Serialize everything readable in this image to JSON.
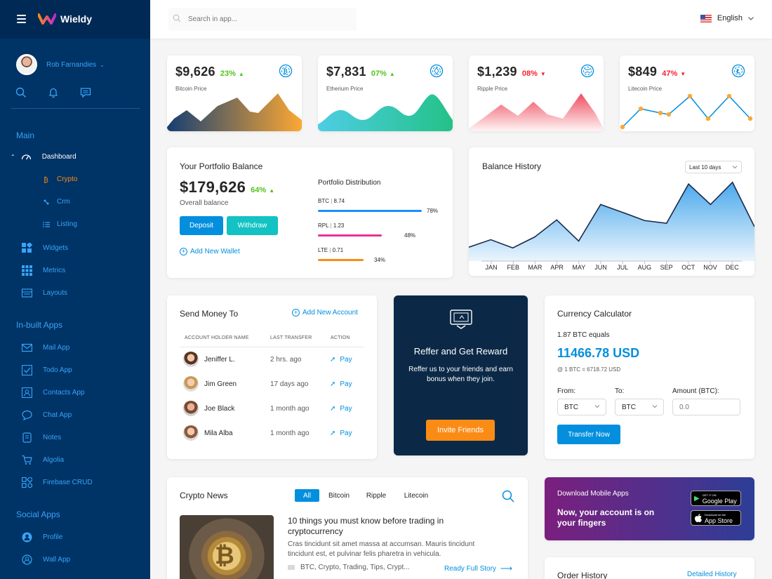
{
  "app": {
    "name": "Wieldy"
  },
  "colors": {
    "primary": "#038fde",
    "sidebar": "#003366",
    "sidebar_top": "#002a55",
    "orange": "#fa8c16",
    "up": "#52c41a",
    "down": "#f5222d",
    "dark_card": "#003366"
  },
  "sidebar": {
    "user_name": "Rob Farnandies",
    "quick_icons": [
      "search-icon",
      "bell-icon",
      "chat-icon"
    ],
    "sections": {
      "main": "Main",
      "inbuilt": "In-built Apps",
      "social": "Social Apps"
    },
    "main_items": [
      {
        "label": "Dashboard",
        "icon": "dashboard-icon"
      },
      {
        "label": "Crypto",
        "icon": "bitcoin-icon"
      },
      {
        "label": "Crm",
        "icon": "crm-icon"
      },
      {
        "label": "Listing",
        "icon": "list-icon"
      },
      {
        "label": "Widgets",
        "icon": "widgets-icon"
      },
      {
        "label": "Metrics",
        "icon": "metrics-icon"
      },
      {
        "label": "Layouts",
        "icon": "layouts-icon"
      }
    ],
    "app_items": [
      {
        "label": "Mail App",
        "icon": "mail-icon"
      },
      {
        "label": "Todo App",
        "icon": "todo-icon"
      },
      {
        "label": "Contacts App",
        "icon": "contacts-icon"
      },
      {
        "label": "Chat App",
        "icon": "chat-icon"
      },
      {
        "label": "Notes",
        "icon": "notes-icon"
      },
      {
        "label": "Algolia",
        "icon": "cart-icon"
      },
      {
        "label": "Firebase CRUD",
        "icon": "firebase-icon"
      }
    ],
    "social_items": [
      {
        "label": "Profile",
        "icon": "profile-icon"
      },
      {
        "label": "Wall App",
        "icon": "wall-icon"
      }
    ]
  },
  "topbar": {
    "search_placeholder": "Search in app...",
    "language": "English"
  },
  "prices": [
    {
      "value": "$9,626",
      "change": "23%",
      "direction": "up",
      "label": "Bitcoin Price",
      "icon": "bitcoin-icon"
    },
    {
      "value": "$7,831",
      "change": "07%",
      "direction": "up",
      "label": "Etherium Price",
      "icon": "ethereum-icon"
    },
    {
      "value": "$1,239",
      "change": "08%",
      "direction": "down",
      "label": "Ripple Price",
      "icon": "ripple-icon"
    },
    {
      "value": "$849",
      "change": "47%",
      "direction": "down",
      "label": "Litecoin Price",
      "icon": "litecoin-icon"
    }
  ],
  "portfolio": {
    "title": "Your Portfolio Balance",
    "balance": "$179,626",
    "change": "64%",
    "subtitle": "Overall balance",
    "deposit": "Deposit",
    "withdraw": "Withdraw",
    "add_wallet": "Add New Wallet",
    "dist_title": "Portfolio Distribution",
    "distribution": [
      {
        "coin": "BTC",
        "amount": "8.74",
        "percent": "78%",
        "fraction": 0.78,
        "color": "#1890ff"
      },
      {
        "coin": "RPL",
        "amount": "1.23",
        "percent": "48%",
        "fraction": 0.48,
        "color": "#eb2f96"
      },
      {
        "coin": "LTE",
        "amount": "0.71",
        "percent": "34%",
        "fraction": 0.34,
        "color": "#fa8c16"
      }
    ]
  },
  "balance_history": {
    "title": "Balance History",
    "range": "Last 10 days"
  },
  "chart_data": {
    "type": "area",
    "categories": [
      "JAN",
      "FEB",
      "MAR",
      "APR",
      "MAY",
      "JUN",
      "JUL",
      "AUG",
      "SEP",
      "OCT",
      "NOV",
      "DEC"
    ],
    "series": [
      {
        "values": [
          20,
          42,
          18,
          50,
          100,
          38,
          145,
          122,
          98,
          90,
          205,
          145,
          210,
          80
        ]
      }
    ],
    "ylim": [
      0,
      230
    ],
    "grid": false,
    "xlabel": "",
    "ylabel": ""
  },
  "send_money": {
    "title": "Send Money To",
    "add_account": "Add New Account",
    "headers": [
      "ACCOUNT HOLDER NAME",
      "LAST TRANSFER",
      "ACTION"
    ],
    "rows": [
      {
        "name": "Jeniffer L.",
        "time": "2 hrs. ago",
        "action": "Pay"
      },
      {
        "name": "Jim Green",
        "time": "17 days ago",
        "action": "Pay"
      },
      {
        "name": "Joe Black",
        "time": "1 month ago",
        "action": "Pay"
      },
      {
        "name": "Mila Alba",
        "time": "1 month ago",
        "action": "Pay"
      }
    ]
  },
  "refer": {
    "title": "Reffer and Get Reward",
    "text": "Reffer us to your friends and earn bonus when they join.",
    "button": "Invite Friends"
  },
  "calculator": {
    "title": "Currency Calculator",
    "equals": "1.87 BTC equals",
    "result": "11466.78 USD",
    "rate": "@ 1 BTC = 6718.72 USD",
    "from_label": "From:",
    "to_label": "To:",
    "amount_label": "Amount (BTC):",
    "from": "BTC",
    "to": "BTC",
    "amount_placeholder": "0.0",
    "button": "Transfer Now"
  },
  "news": {
    "title": "Crypto News",
    "tabs": [
      "All",
      "Bitcoin",
      "Ripple",
      "Litecoin"
    ],
    "headline": "10 things you must know before trading in cryptocurrency",
    "body": "Cras tincidunt sit amet massa at accumsan. Mauris tincidunt tincidunt est, et pulvinar felis pharetra in vehicula.",
    "tags": "BTC, Crypto, Trading, Tips, Crypt...",
    "read_more": "Ready Full Story"
  },
  "mobile": {
    "title": "Download Mobile Apps",
    "text": "Now, your account is on your fingers",
    "google_small": "GET IT ON",
    "google": "Google Play",
    "apple_small": "Download on the",
    "apple": "App Store"
  },
  "order_history": {
    "title": "Order History",
    "link": "Detailed History"
  }
}
